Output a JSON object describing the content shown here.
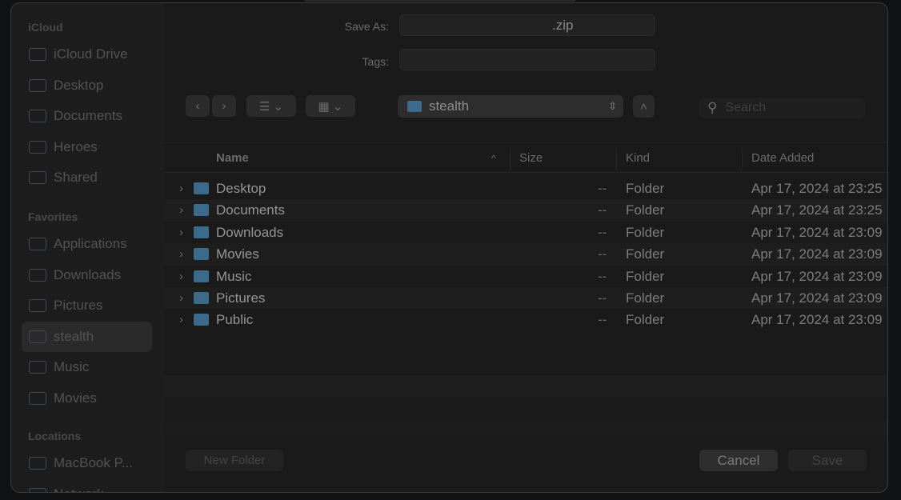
{
  "dialog": {
    "save_as_label": "Save As:",
    "save_as_value": ".zip",
    "tags_label": "Tags:",
    "tags_value": "",
    "location": "stealth",
    "search_placeholder": "Search",
    "new_folder": "New Folder",
    "cancel": "Cancel",
    "save": "Save"
  },
  "sidebar": {
    "sections": [
      {
        "title": "iCloud",
        "items": [
          {
            "label": "iCloud Drive",
            "icon": "cloud-icon"
          },
          {
            "label": "Desktop",
            "icon": "desktop-icon"
          },
          {
            "label": "Documents",
            "icon": "document-icon"
          },
          {
            "label": "Heroes",
            "icon": "folder-icon"
          },
          {
            "label": "Shared",
            "icon": "shared-folder-icon"
          }
        ]
      },
      {
        "title": "Favorites",
        "items": [
          {
            "label": "Applications",
            "icon": "applications-icon"
          },
          {
            "label": "Downloads",
            "icon": "download-icon"
          },
          {
            "label": "Pictures",
            "icon": "pictures-icon"
          },
          {
            "label": "stealth",
            "icon": "home-icon",
            "selected": true
          },
          {
            "label": "Music",
            "icon": "music-icon"
          },
          {
            "label": "Movies",
            "icon": "movies-icon"
          }
        ]
      },
      {
        "title": "Locations",
        "items": [
          {
            "label": "MacBook P...",
            "icon": "laptop-icon"
          },
          {
            "label": "Network",
            "icon": "network-icon"
          }
        ]
      }
    ]
  },
  "columns": [
    "Name",
    "Size",
    "Kind",
    "Date Added"
  ],
  "files": [
    {
      "name": "Desktop",
      "size": "--",
      "kind": "Folder",
      "date": "Apr 17, 2024 at 23:25"
    },
    {
      "name": "Documents",
      "size": "--",
      "kind": "Folder",
      "date": "Apr 17, 2024 at 23:25"
    },
    {
      "name": "Downloads",
      "size": "--",
      "kind": "Folder",
      "date": "Apr 17, 2024 at 23:09"
    },
    {
      "name": "Movies",
      "size": "--",
      "kind": "Folder",
      "date": "Apr 17, 2024 at 23:09"
    },
    {
      "name": "Music",
      "size": "--",
      "kind": "Folder",
      "date": "Apr 17, 2024 at 23:09"
    },
    {
      "name": "Pictures",
      "size": "--",
      "kind": "Folder",
      "date": "Apr 17, 2024 at 23:09"
    },
    {
      "name": "Public",
      "size": "--",
      "kind": "Folder",
      "date": "Apr 17, 2024 at 23:09"
    }
  ]
}
